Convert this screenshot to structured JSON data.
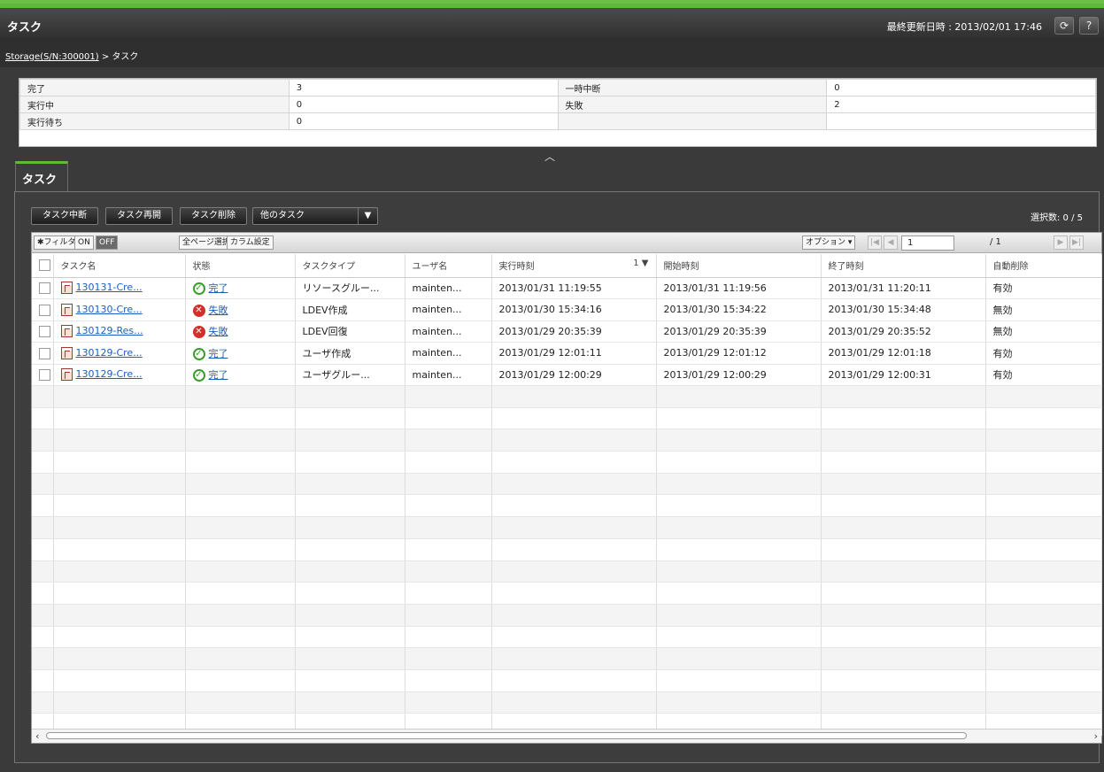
{
  "header": {
    "title": "タスク",
    "last_update": "最終更新日時 : 2013/02/01 17:46",
    "refresh_icon": "refresh-icon",
    "help_icon": "help-icon",
    "help_label": "?"
  },
  "breadcrumb": {
    "storage": "Storage(S/N:300001)",
    "separator": " > ",
    "current": "タスク"
  },
  "summary": {
    "rows": [
      {
        "label1": "完了",
        "value1": "3",
        "label2": "一時中断",
        "value2": "0"
      },
      {
        "label1": "実行中",
        "value1": "0",
        "label2": "失敗",
        "value2": "2"
      },
      {
        "label1": "実行待ち",
        "value1": "0",
        "label2": "",
        "value2": ""
      }
    ]
  },
  "tab": {
    "label": "タスク"
  },
  "actions": {
    "suspend": "タスク中断",
    "resume": "タスク再開",
    "delete": "タスク削除",
    "other": "他のタスク",
    "dropdown_caret": "▼"
  },
  "selection": "選択数: 0 / 5",
  "toolbar": {
    "filter": "✱フィルタ",
    "on": "ON",
    "off": "OFF",
    "select_all": "全ページ選択",
    "column_settings": "カラム設定",
    "options": "オプション ▾",
    "page_value": "1",
    "page_total": "/ 1"
  },
  "columns": [
    "タスク名",
    "状態",
    "タスクタイプ",
    "ユーザ名",
    "実行時刻",
    "開始時刻",
    "終了時刻",
    "自動削除"
  ],
  "sort_indicator": "1 ▼",
  "rows": [
    {
      "name": "130131-Cre...",
      "status": "完了",
      "status_kind": "ok",
      "type": "リソースグルー...",
      "user": "mainten...",
      "exec": "2013/01/31 11:19:55",
      "start": "2013/01/31 11:19:56",
      "end": "2013/01/31 11:20:11",
      "auto": "有効"
    },
    {
      "name": "130130-Cre...",
      "status": "失敗",
      "status_kind": "ng",
      "type": "LDEV作成",
      "user": "mainten...",
      "exec": "2013/01/30 15:34:16",
      "start": "2013/01/30 15:34:22",
      "end": "2013/01/30 15:34:48",
      "auto": "無効"
    },
    {
      "name": "130129-Res...",
      "status": "失敗",
      "status_kind": "ng",
      "type": "LDEV回復",
      "user": "mainten...",
      "exec": "2013/01/29 20:35:39",
      "start": "2013/01/29 20:35:39",
      "end": "2013/01/29 20:35:52",
      "auto": "無効"
    },
    {
      "name": "130129-Cre...",
      "status": "完了",
      "status_kind": "ok",
      "type": "ユーザ作成",
      "user": "mainten...",
      "exec": "2013/01/29 12:01:11",
      "start": "2013/01/29 12:01:12",
      "end": "2013/01/29 12:01:18",
      "auto": "有効"
    },
    {
      "name": "130129-Cre...",
      "status": "完了",
      "status_kind": "ok",
      "type": "ユーザグルー...",
      "user": "mainten...",
      "exec": "2013/01/29 12:00:29",
      "start": "2013/01/29 12:00:29",
      "end": "2013/01/29 12:00:31",
      "auto": "有効"
    }
  ],
  "status_glyphs": {
    "ok": "✓",
    "ng": "✕"
  },
  "colors": {
    "accent": "#5dba3a",
    "ok": "#3a9e2b",
    "ng": "#d0312d",
    "link": "#1a5fbf"
  }
}
